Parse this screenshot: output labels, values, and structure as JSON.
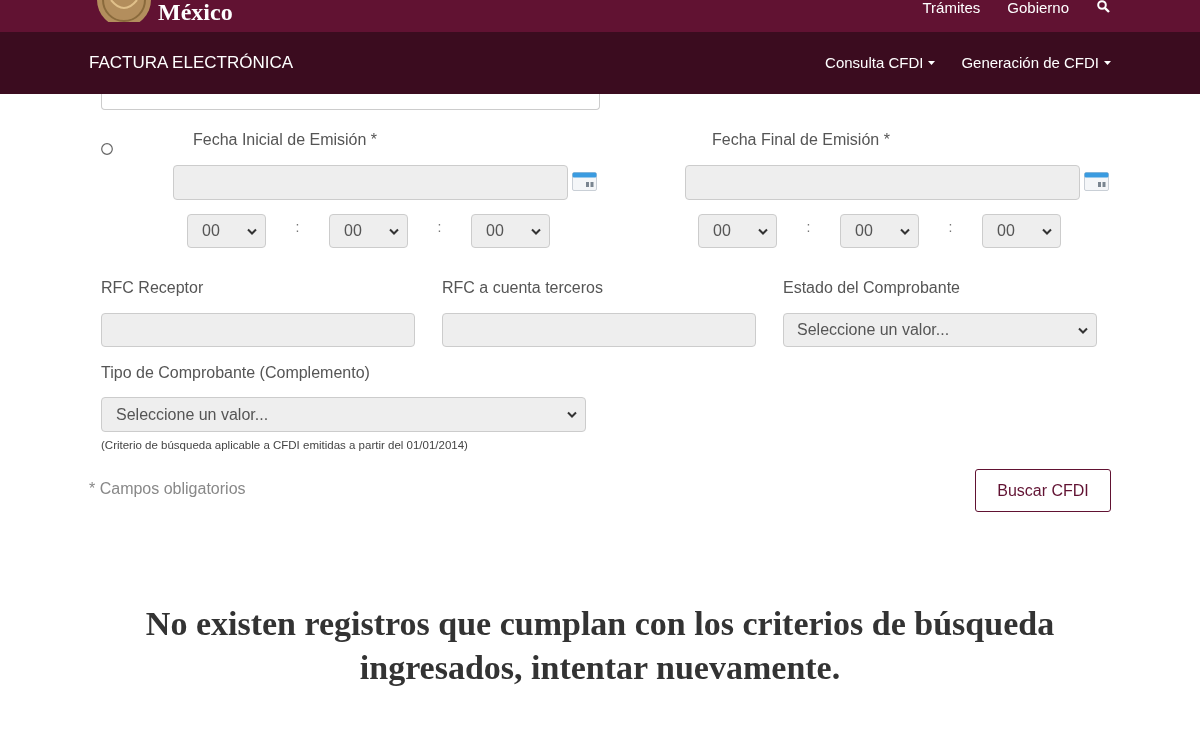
{
  "header": {
    "logo_text": "México",
    "links": [
      {
        "label": "Trámites"
      },
      {
        "label": "Gobierno"
      }
    ]
  },
  "navbar": {
    "title": "FACTURA ELECTRÓNICA",
    "menus": [
      {
        "label": "Consulta CFDI"
      },
      {
        "label": "Generación de CFDI"
      }
    ]
  },
  "date_search": {
    "selected": false,
    "ranges": [
      {
        "label": "Fecha Inicial de Emisión *",
        "time": [
          {
            "kind": "select",
            "value": "00"
          },
          {
            "kind": "separator",
            "text": ":"
          },
          {
            "kind": "select",
            "value": "00"
          },
          {
            "kind": "separator",
            "text": ":"
          },
          {
            "kind": "select",
            "value": "00"
          }
        ]
      },
      {
        "label": "Fecha Final de Emisión *",
        "time": [
          {
            "kind": "select",
            "value": "00"
          },
          {
            "kind": "separator",
            "text": ":"
          },
          {
            "kind": "select",
            "value": "00"
          },
          {
            "kind": "separator",
            "text": ":"
          },
          {
            "kind": "select",
            "value": "00"
          }
        ]
      }
    ]
  },
  "fields": [
    {
      "kind": "text",
      "label": "RFC Receptor"
    },
    {
      "kind": "text",
      "label": "RFC a cuenta terceros"
    },
    {
      "kind": "select",
      "label": "Estado del Comprobante",
      "value": "Seleccione un valor..."
    }
  ],
  "type_field": {
    "label": "Tipo de Comprobante (Complemento)",
    "value": "Seleccione un valor...",
    "note": "(Criterio de búsqueda aplicable a CFDI emitidas a partir del 01/01/2014)"
  },
  "required_note": "* Campos obligatorios",
  "search_button": "Buscar CFDI",
  "message": "No existen registros que cumplan con los criterios de búsqueda ingresados, intentar nuevamente."
}
